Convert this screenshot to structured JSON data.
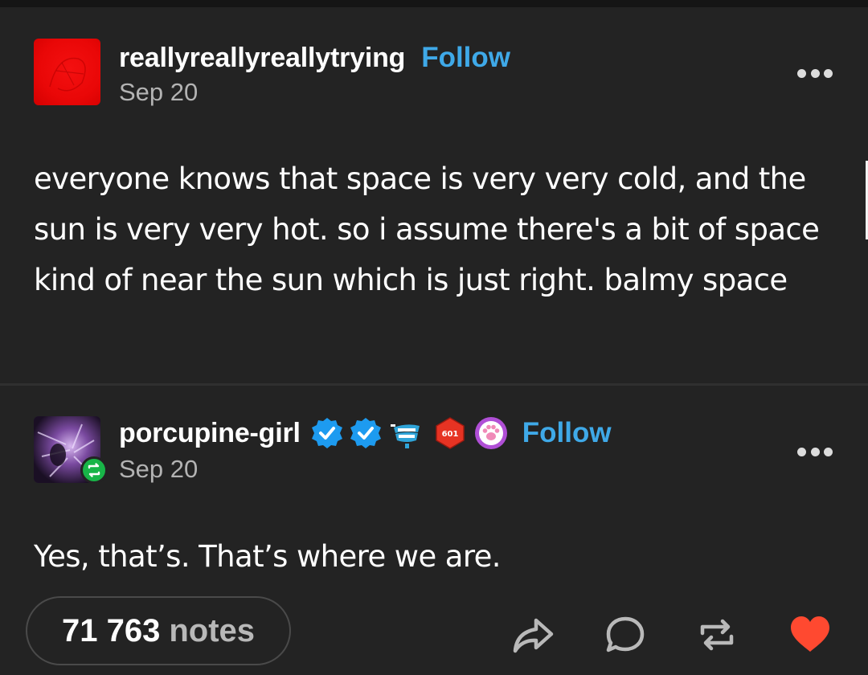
{
  "posts": [
    {
      "username": "reallyreallyreallytrying",
      "follow_label": "Follow",
      "date": "Sep 20",
      "body": "everyone knows that space is very very cold, and the sun is very very hot. so i assume there's a bit of space kind of near the sun which is just right. balmy space",
      "avatar_color": "#e90707"
    },
    {
      "username": "porcupine-girl",
      "follow_label": "Follow",
      "date": "Sep 20",
      "body": "Yes, that’s. That’s where we are.",
      "badges": [
        "verified-check-icon",
        "verified-check-icon",
        "dentures-icon",
        "d20-dice-icon",
        "paw-print-icon"
      ],
      "dice_label": "601"
    }
  ],
  "footer": {
    "notes_count": "71 763",
    "notes_word": "notes",
    "actions": [
      "share-icon",
      "reply-icon",
      "reblog-icon",
      "like-icon"
    ]
  },
  "colors": {
    "background": "#232323",
    "link_blue": "#3fa9e8",
    "like_red": "#ff4930",
    "reblog_green": "#18b548",
    "verified_blue": "#1d9bf0"
  }
}
